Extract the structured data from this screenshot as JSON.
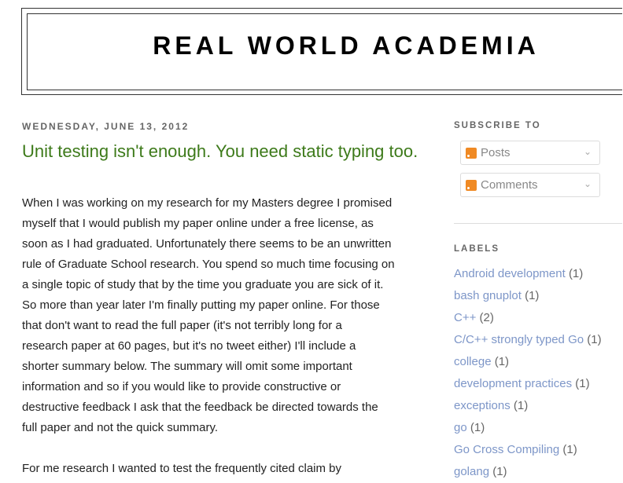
{
  "header": {
    "title": "REAL WORLD ACADEMIA"
  },
  "post": {
    "date": "WEDNESDAY, JUNE 13, 2012",
    "title": "Unit testing isn't enough. You need static typing too.",
    "paragraphs": [
      [
        "When I was working on my research for my Masters degree I promised",
        "myself that I would publish my paper online under a free license, as",
        "soon as I had graduated. Unfortunately there seems to be an unwritten",
        "rule of Graduate School research. You spend so much time focusing on",
        "a single topic of study that by the time you graduate you are sick of it.",
        "So more than year later I'm finally putting my paper online. For those",
        "that don't want to read the full paper (it's not terribly long for a",
        "research paper at 60 pages, but it's no tweet either) I'll include a",
        "shorter summary below. The summary will omit some important",
        "information and so if you would like to provide constructive or",
        "destructive feedback I ask that the feedback be directed towards the",
        "full paper and not the quick summary."
      ],
      [
        "For me research I wanted to test the frequently cited claim by"
      ]
    ]
  },
  "sidebar": {
    "subscribe_heading": "SUBSCRIBE TO",
    "feeds": [
      {
        "label": "Posts",
        "icon": "rss-icon"
      },
      {
        "label": "Comments",
        "icon": "rss-icon"
      }
    ],
    "labels_heading": "LABELS",
    "labels": [
      {
        "name": "Android development",
        "count": "(1)"
      },
      {
        "name": "bash gnuplot",
        "count": "(1)"
      },
      {
        "name": "C++",
        "count": "(2)"
      },
      {
        "name": "C/C++ strongly typed Go",
        "count": "(1)"
      },
      {
        "name": "college",
        "count": "(1)"
      },
      {
        "name": "development practices",
        "count": "(1)"
      },
      {
        "name": "exceptions",
        "count": "(1)"
      },
      {
        "name": "go",
        "count": "(1)"
      },
      {
        "name": "Go Cross Compiling",
        "count": "(1)"
      },
      {
        "name": "golang",
        "count": "(1)"
      }
    ]
  },
  "colors": {
    "title_green": "#3d7a1a",
    "label_link": "#7d96c8",
    "rss": "#f08a24"
  }
}
